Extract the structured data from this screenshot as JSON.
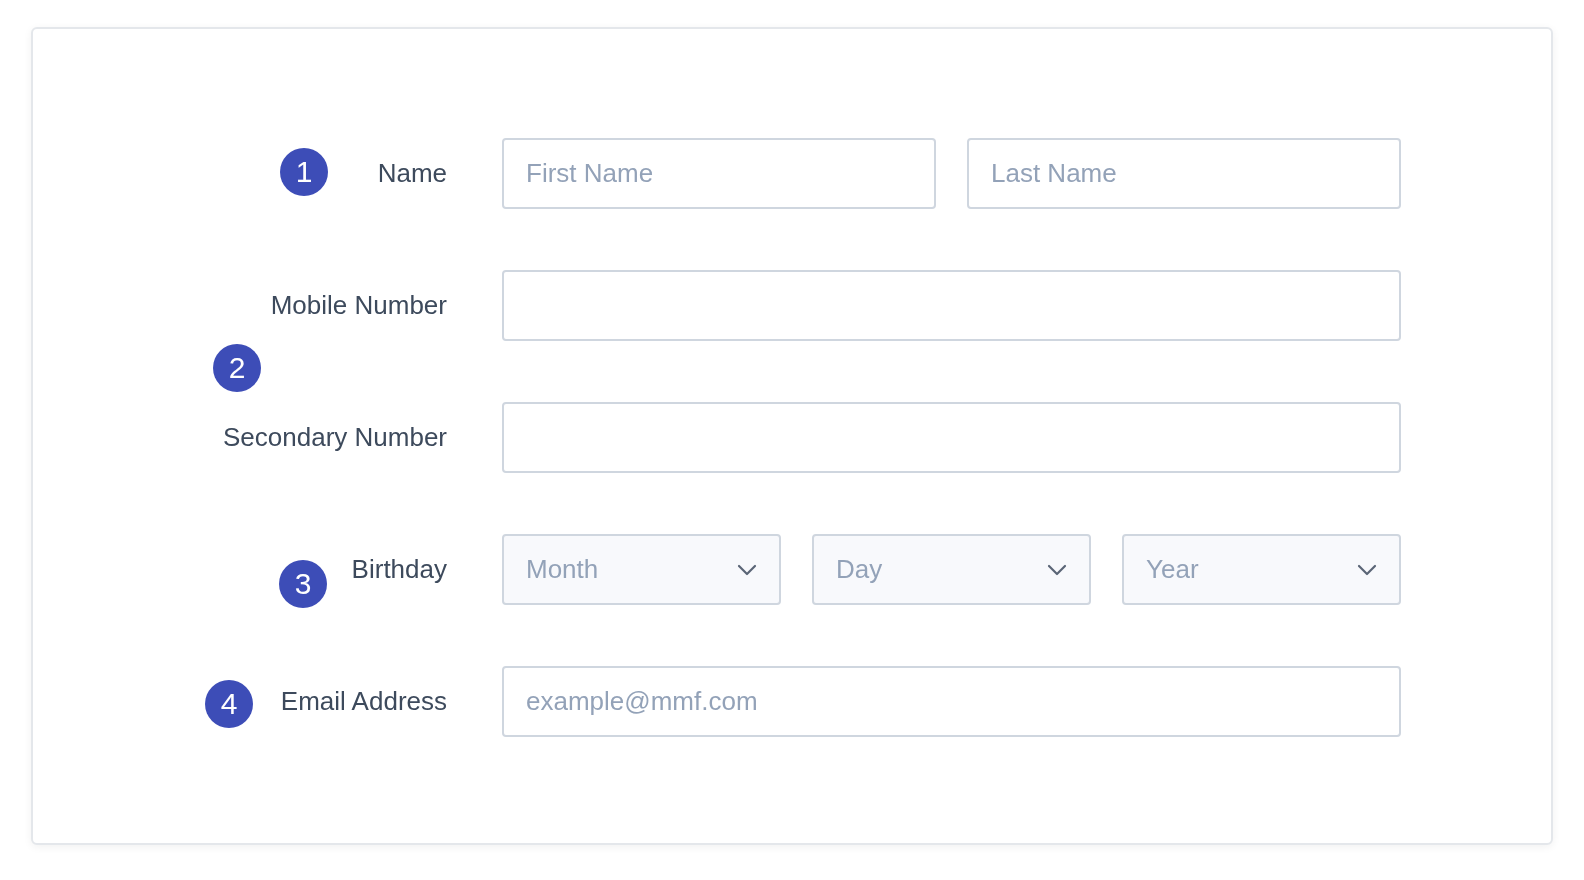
{
  "rows": [
    {
      "label": "Name",
      "fields": [
        {
          "kind": "input",
          "placeholder": "First Name"
        },
        {
          "kind": "input",
          "placeholder": "Last Name"
        }
      ]
    },
    {
      "label": "Mobile Number",
      "fields": [
        {
          "kind": "input"
        }
      ]
    },
    {
      "label": "Secondary Number",
      "fields": [
        {
          "kind": "input"
        }
      ]
    },
    {
      "label": "Birthday",
      "fields": [
        {
          "kind": "select",
          "placeholder": "Month"
        },
        {
          "kind": "select",
          "placeholder": "Day"
        },
        {
          "kind": "select",
          "placeholder": "Year"
        }
      ]
    },
    {
      "label": "Email Address",
      "fields": [
        {
          "kind": "input",
          "placeholder": "example@mmf.com"
        }
      ]
    }
  ],
  "badges": [
    {
      "number": "1"
    },
    {
      "number": "2"
    },
    {
      "number": "3"
    },
    {
      "number": "4"
    }
  ]
}
